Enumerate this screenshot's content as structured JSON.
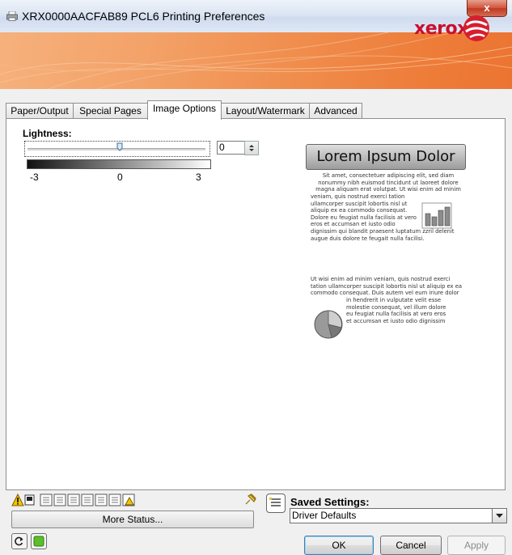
{
  "window": {
    "title": "XRX0000AACFAB89 PCL6 Printing Preferences",
    "close_glyph": "x"
  },
  "banner": {
    "brand": "xerox"
  },
  "tabs": [
    {
      "label": "Paper/Output",
      "active": false
    },
    {
      "label": "Special Pages",
      "active": false
    },
    {
      "label": "Image Options",
      "active": true
    },
    {
      "label": "Layout/Watermark",
      "active": false
    },
    {
      "label": "Advanced",
      "active": false
    }
  ],
  "lightness": {
    "label": "Lightness:",
    "value": "0",
    "min_label": "-3",
    "mid_label": "0",
    "max_label": "3"
  },
  "preview": {
    "title": "Lorem Ipsum Dolor",
    "para1": [
      "Sit amet, consectetuer adipiscing elit, sed diam",
      "nonummy nibh euismod tincidunt ut laoreet dolore",
      "magna aliquam erat volutpat. Ut wisi enim ad minim",
      "veniam, quis nostrud exerci tation"
    ],
    "para1_left": [
      "ullamcorper suscipit lobortis nisl ut",
      "aliquip ex ea commodo consequat.",
      "Dolore eu feugiat nulla facilisis at vero",
      "eros et accumsan et iusto odio"
    ],
    "para1_end": [
      "dignissim qui blandit praesent luptatum zzril delenit",
      "augue duis dolore te feugait nulla facilisi."
    ],
    "para2": [
      "Ut wisi enim ad minim veniam, quis nostrud exerci",
      "tation ullamcorper suscipit lobortis nisl ut aliquip ex ea",
      "commodo consequat. Duis autem vel eum iriure dolor"
    ],
    "para2_right": [
      "in hendrerit in vulputate velit esse",
      "molestie consequat, vel illum dolore",
      "eu feugiat nulla facilisis at vero eros",
      "et accumsan et iusto odio dignissim"
    ]
  },
  "status": {
    "more_status_label": "More Status..."
  },
  "saved_settings": {
    "label": "Saved Settings:",
    "value": "Driver Defaults"
  },
  "buttons": {
    "ok": "OK",
    "cancel": "Cancel",
    "apply": "Apply"
  }
}
